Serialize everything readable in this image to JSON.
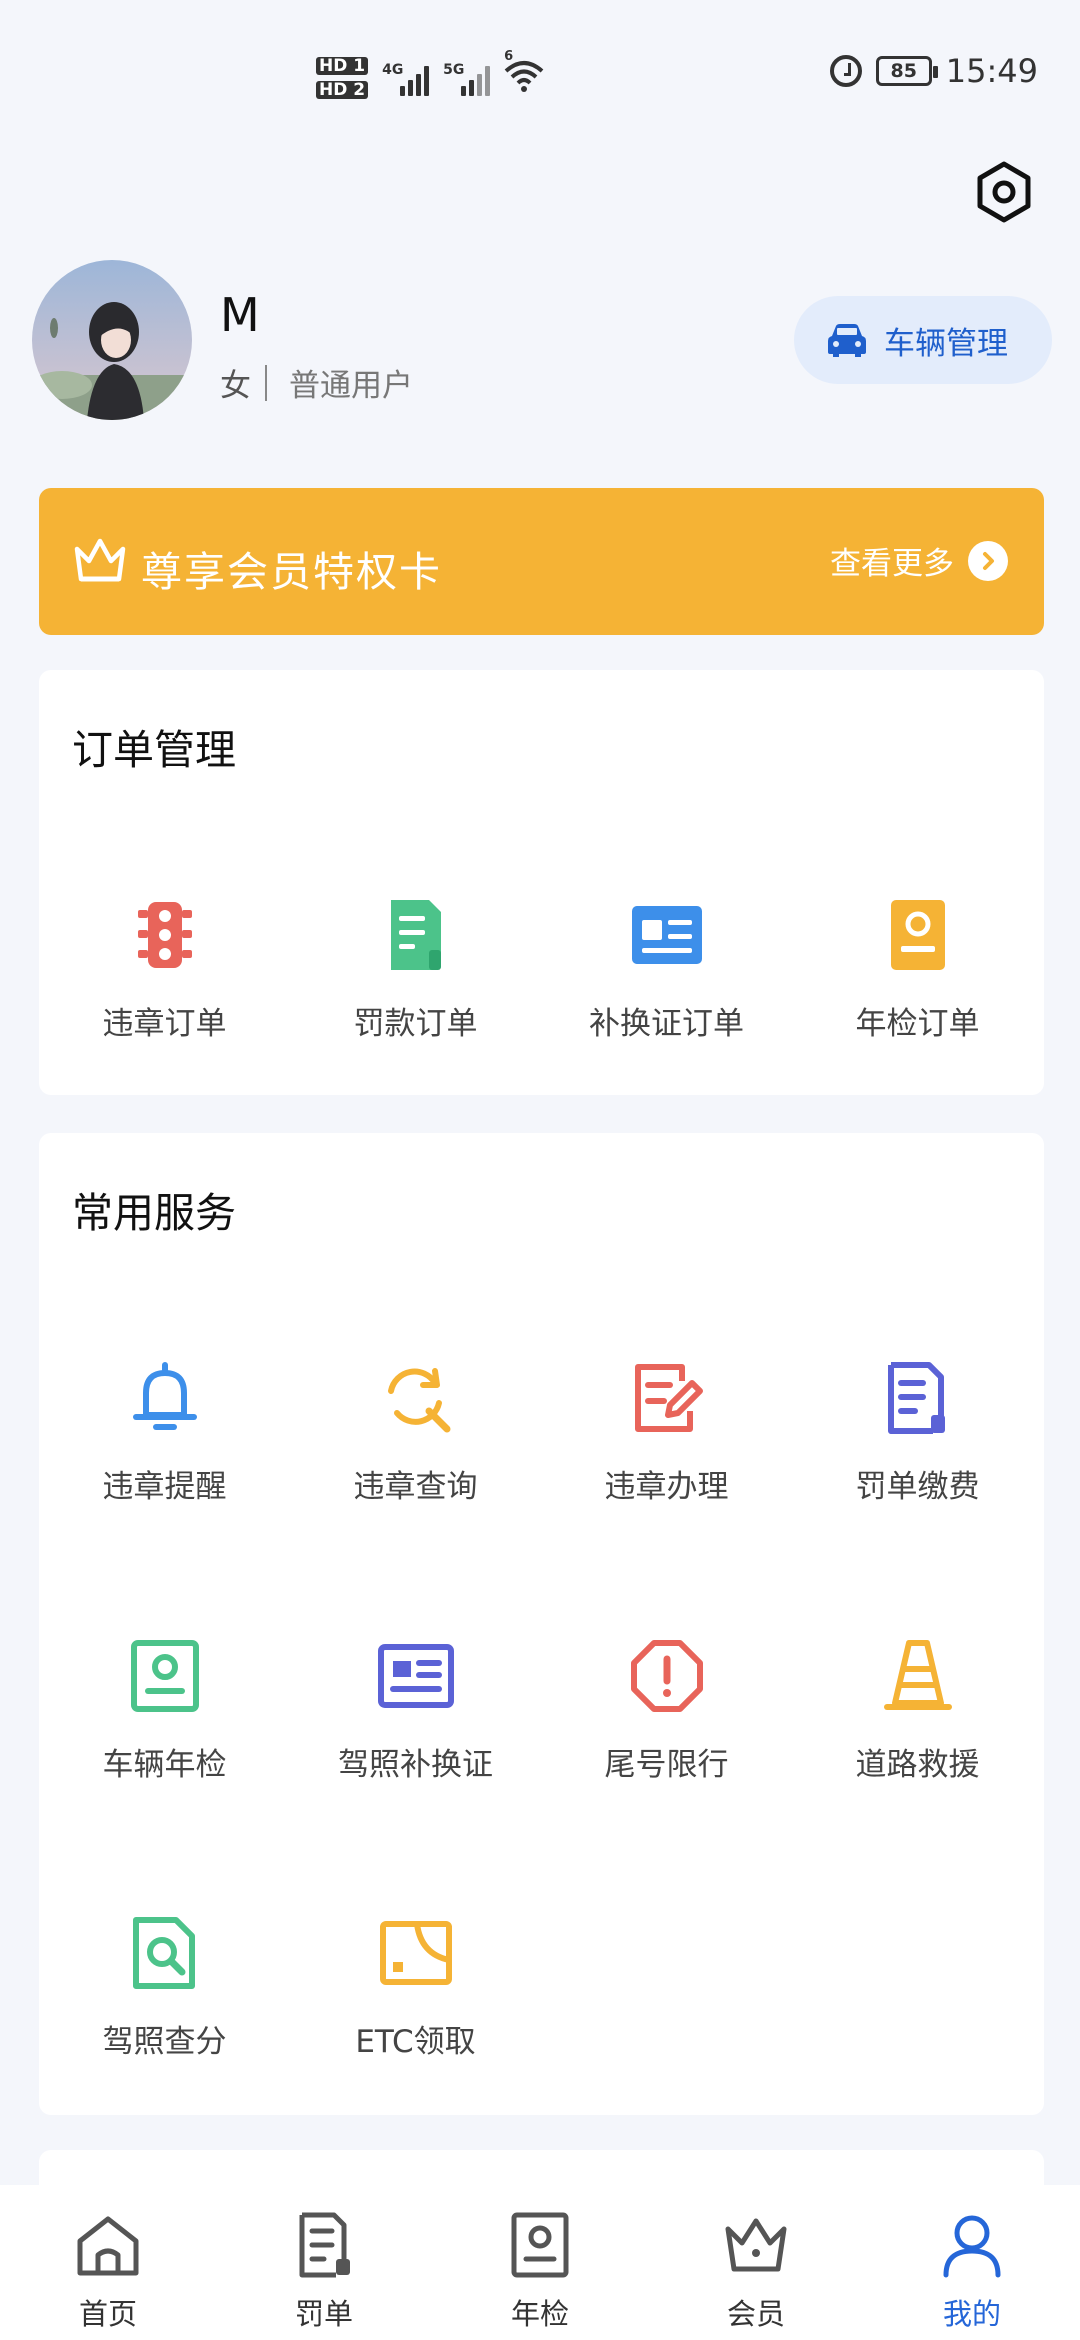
{
  "status_bar": {
    "sim1": "HD 1",
    "sim2": "HD 2",
    "net1": "4G",
    "net2": "5G",
    "wifi_gen": "6",
    "battery": "85",
    "time": "15:49"
  },
  "header": {
    "settings_icon": "settings-hexagon-icon"
  },
  "profile": {
    "name": "M",
    "gender": "女",
    "role": "普通用户",
    "vehicle_button": "车辆管理"
  },
  "vip": {
    "title": "尊享会员特权卡",
    "more": "查看更多",
    "color": "#F5B335"
  },
  "orders": {
    "title": "订单管理",
    "items": [
      {
        "label": "违章订单",
        "icon": "traffic-light-icon",
        "color": "#E8645A"
      },
      {
        "label": "罚款订单",
        "icon": "receipt-icon",
        "color": "#4CC38A"
      },
      {
        "label": "补换证订单",
        "icon": "id-card-icon",
        "color": "#3D8FEA"
      },
      {
        "label": "年检订单",
        "icon": "inspection-badge-icon",
        "color": "#F5B335"
      }
    ]
  },
  "services": {
    "title": "常用服务",
    "items": [
      {
        "label": "违章提醒",
        "icon": "bell-icon",
        "color": "#3D8FEA"
      },
      {
        "label": "违章查询",
        "icon": "refresh-search-icon",
        "color": "#F5B335"
      },
      {
        "label": "违章办理",
        "icon": "edit-document-icon",
        "color": "#E8645A"
      },
      {
        "label": "罚单缴费",
        "icon": "bill-icon",
        "color": "#5B62D6"
      },
      {
        "label": "车辆年检",
        "icon": "inspection-card-icon",
        "color": "#4CC38A"
      },
      {
        "label": "驾照补换证",
        "icon": "license-card-icon",
        "color": "#5B62D6"
      },
      {
        "label": "尾号限行",
        "icon": "warning-octagon-icon",
        "color": "#E8645A"
      },
      {
        "label": "道路救援",
        "icon": "traffic-cone-icon",
        "color": "#F5B335"
      },
      {
        "label": "驾照查分",
        "icon": "document-search-icon",
        "color": "#4CC38A"
      },
      {
        "label": "ETC领取",
        "icon": "etc-card-icon",
        "color": "#F5B335"
      }
    ]
  },
  "tabs": [
    {
      "label": "首页",
      "icon": "home-icon"
    },
    {
      "label": "罚单",
      "icon": "ticket-icon"
    },
    {
      "label": "年检",
      "icon": "inspection-icon"
    },
    {
      "label": "会员",
      "icon": "crown-icon"
    },
    {
      "label": "我的",
      "icon": "user-icon",
      "active": true
    }
  ],
  "colors": {
    "accent": "#2566D8",
    "background": "#F4F6FB"
  }
}
